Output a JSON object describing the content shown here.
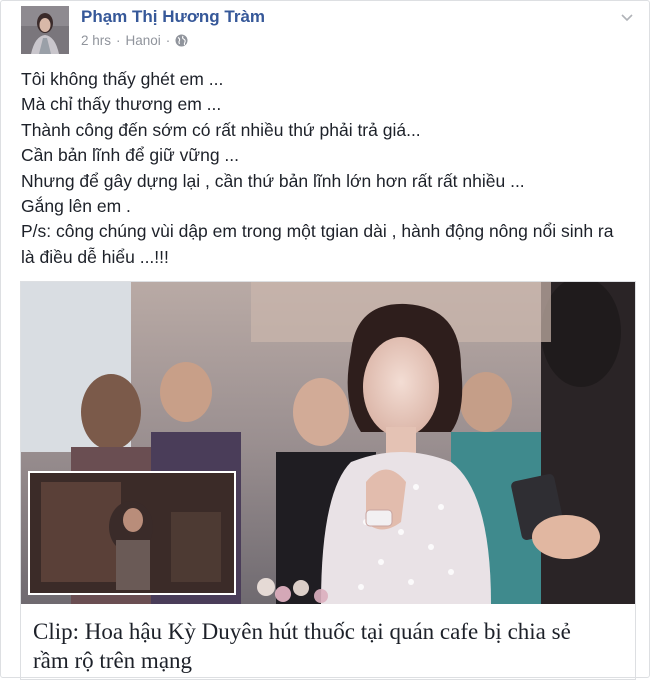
{
  "post": {
    "author": "Phạm Thị Hương Tràm",
    "time": "2 hrs",
    "separator": "·",
    "location": "Hanoi",
    "privacy_icon": "globe-icon",
    "menu_icon": "chevron-down-icon",
    "lines": [
      "Tôi không thấy ghét em ...",
      "Mà chỉ thấy thương em ...",
      "Thành công đến sớm có rất nhiều thứ phải trả giá...",
      "Cần bản lĩnh để giữ vững ...",
      "Nhưng để gây dựng lại , cần thứ bản lĩnh lớn hơn rất rất nhiều ...",
      "Gắng lên em .",
      "P/s: công chúng vùi dập em trong một tgian dài , hành động nông nổi sinh ra",
      "là điều dễ hiểu ...!!!"
    ]
  },
  "link": {
    "title_line1": "Clip: Hoa hậu Kỳ Duyên hút thuốc tại quán cafe bị chia sẻ",
    "title_line2": "rầm rộ trên mạng"
  },
  "colors": {
    "author": "#365899",
    "meta": "#90949c",
    "text": "#1d2129",
    "border": "#dddfe2"
  }
}
